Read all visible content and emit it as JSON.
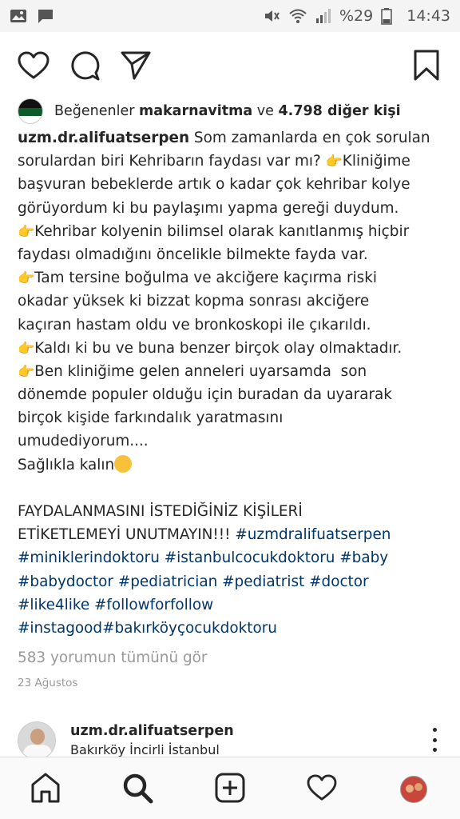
{
  "status_bar": {
    "battery": "%29",
    "time": "14:43"
  },
  "post": {
    "likes": {
      "prefix": "Beğenenler",
      "user": "makarnavitma",
      "connector": "ve",
      "others": "4.798 diğer kişi"
    },
    "caption": {
      "username": "uzm.dr.alifuatserpen",
      "line1_rest": " Som zamanlarda en çok sorulan",
      "line2": "sorulardan biri Kehribarın faydası var mı? ",
      "line2_end": "Kliniğime",
      "line3": "başvuran bebeklerde artık o kadar çok kehribar kolye",
      "line4": "görüyordum ki bu paylaşımı yapma gereği duydum.",
      "line5": "Kehribar kolyenin bilimsel olarak kanıtlanmış hiçbir",
      "line6": "faydası olmadığını öncelikle bilmekte fayda var.",
      "line7": "Tam tersine boğulma ve akciğere kaçırma riski",
      "line8": "okadar yüksek ki bizzat kopma sonrası akciğere",
      "line9": "kaçıran hastam oldu ve bronkoskopi ile çıkarıldı.",
      "line10": "Kaldı ki bu ve buna benzer birçok olay olmaktadır.",
      "line11": "Ben kliniğime gelen anneleri uyarsamda  son",
      "line12": "dönemde populer olduğu için buradan da uyararak",
      "line13": "birçok kişide farkındalık yaratmasını",
      "line14": "umudediyorum....",
      "line15": "Sağlıkla kalın",
      "line17": "FAYDALANMASINI İSTEDİĞİNİZ KİŞİLERİ",
      "line18": "ETİKETLEMEYİ UNUTMAYIN!!! ",
      "line18_tag": "#uzmdralifuatserpen",
      "line19": "#miniklerindoktoru #istanbulcocukdoktoru #baby",
      "line20": "#babydoctor #pediatrician #pediatrist #doctor",
      "line21": "#like4like #followforfollow",
      "line22": "#instagood#bakırköyçocukdoktoru"
    },
    "comments_link": "583 yorumun tümünü gör",
    "date": "23 Ağustos"
  },
  "next_post": {
    "username": "uzm.dr.alifuatserpen",
    "location": "Bakırköy İncirli İstanbul"
  },
  "icons": {
    "like": "heart-icon",
    "comment": "comment-icon",
    "share": "send-icon",
    "save": "bookmark-icon",
    "hand": "point-right-emoji",
    "hug": "hugging-face-emoji"
  },
  "colors": {
    "hashtag": "#003569",
    "muted": "#999999",
    "text": "#262626"
  }
}
